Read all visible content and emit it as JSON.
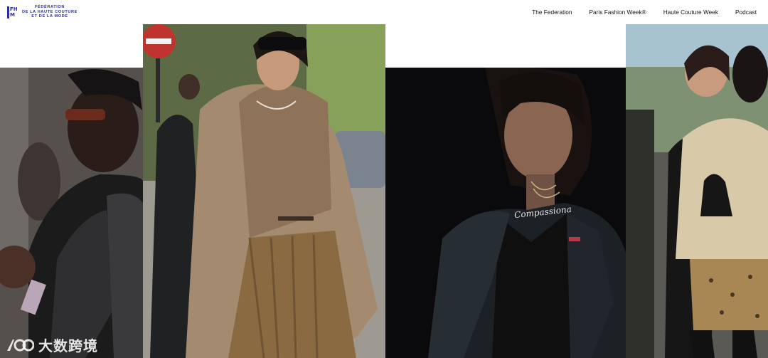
{
  "header": {
    "brand": {
      "mark_top": "FH",
      "mark_bottom": "M",
      "line1": "FÉDÉRATION",
      "line2": "DE LA HAUTE COUTURE",
      "line3": "ET DE LA MODE"
    },
    "nav": [
      {
        "label": "The Federation"
      },
      {
        "label": "Paris Fashion Week®"
      },
      {
        "label": "Haute Couture Week"
      },
      {
        "label": "Podcast"
      }
    ]
  },
  "gallery": {
    "photos": [
      {
        "subject": "street-style-photo-leather-jacket"
      },
      {
        "subject": "street-style-photo-beige-blazer"
      },
      {
        "subject": "street-style-photo-dark-coat",
        "shirt_text": "Compassiona"
      },
      {
        "subject": "street-style-photo-tweed-jacket-hug"
      }
    ]
  },
  "watermark": {
    "logo_text": "100",
    "text": "大数跨境"
  },
  "colors": {
    "brand_blue": "#2b2e9c",
    "nav_text": "#111111",
    "background": "#ffffff"
  }
}
